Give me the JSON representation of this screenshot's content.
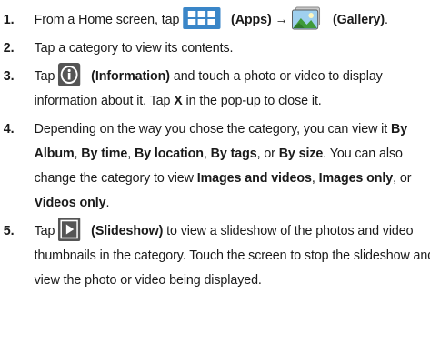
{
  "steps": [
    {
      "num": "1.",
      "t1": "From a Home screen, tap ",
      "icon1": "apps-grid-icon",
      "b1": "(Apps)",
      "arrow": " → ",
      "icon2": "gallery-icon",
      "b2": "(Gallery)",
      "t2": "."
    },
    {
      "num": "2.",
      "text": "Tap a category to view its contents."
    },
    {
      "num": "3.",
      "t1": "Tap ",
      "icon": "information-icon",
      "b1": "(Information)",
      "t2": " and touch a photo or video to display information about it. Tap ",
      "b2": "X",
      "t3": " in the pop-up to close it."
    },
    {
      "num": "4.",
      "t1": "Depending on the way you chose the category, you can view it ",
      "b1": "By Album",
      "t2": ", ",
      "b2": "By time",
      "t3": ", ",
      "b3": "By location",
      "t4": ", ",
      "b4": "By tags",
      "t5": ", or ",
      "b5": "By size",
      "t6": ". You can also change the category to view ",
      "b6": "Images and videos",
      "t7": ", ",
      "b7": "Images only",
      "t8": ", or ",
      "b8": "Videos only",
      "t9": "."
    },
    {
      "num": "5.",
      "t1": "Tap ",
      "icon": "slideshow-play-icon",
      "b1": "(Slideshow)",
      "t2": " to view a slideshow of the photos and video thumbnails in the category. Touch the screen to stop the slideshow and view the photo or video being displayed."
    }
  ],
  "colors": {
    "apps_icon_bg": "#3a86c8",
    "info_icon_bg": "#555555",
    "slideshow_icon_bg": "#555555"
  }
}
